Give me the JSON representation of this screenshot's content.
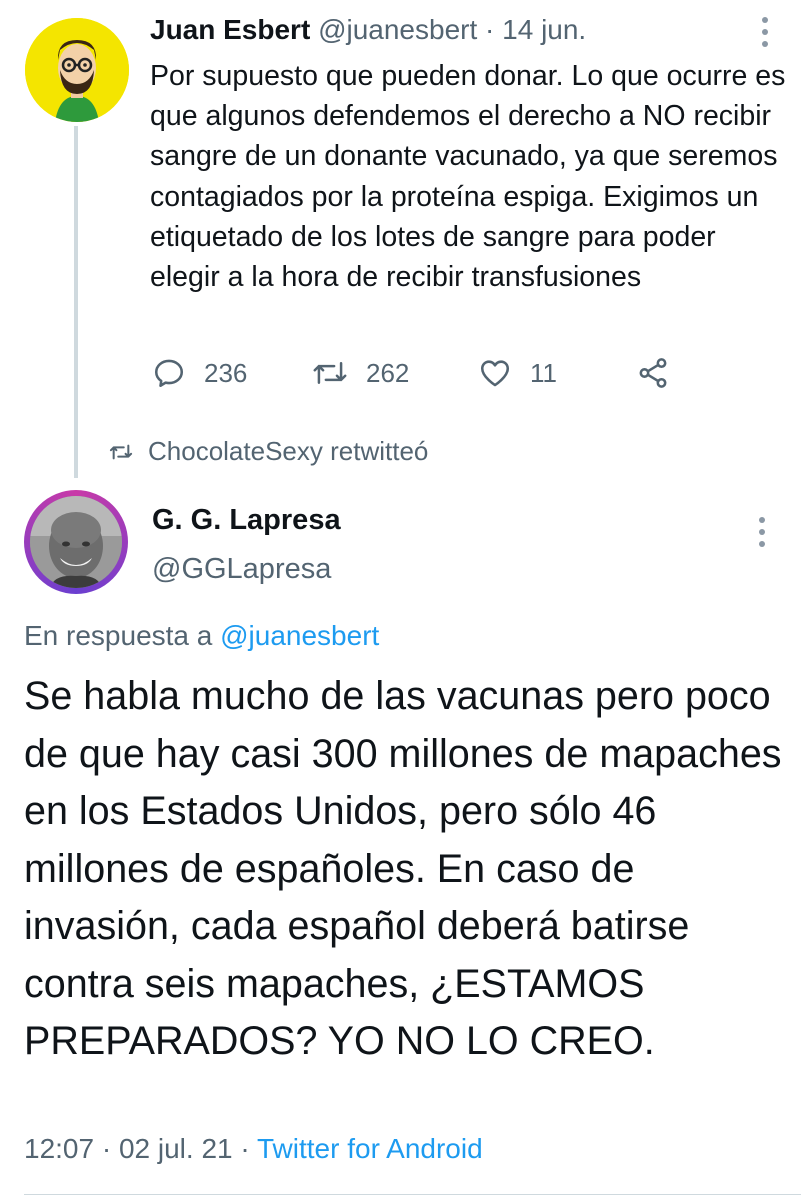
{
  "tweet1": {
    "author_name": "Juan Esbert",
    "author_handle": "@juanesbert",
    "separator": " · ",
    "date": "14 jun.",
    "text": "Por supuesto que pueden donar. Lo que ocurre es que algunos defendemos el derecho a NO recibir sangre de un donante vacunado, ya que seremos contagiados por la proteína espiga. Exigimos un etiquetado de los lotes de sangre para poder elegir a la hora de recibir transfusiones",
    "replies": "236",
    "retweets": "262",
    "likes": "11",
    "icons": [
      "reply-icon",
      "retweet-icon",
      "like-icon",
      "share-icon",
      "more-icon"
    ]
  },
  "retweet_context": {
    "label": "ChocolateSexy retwitteó",
    "icon": "retweet-icon"
  },
  "tweet2": {
    "author_name": "G. G. Lapresa",
    "author_handle": "@GGLapresa",
    "reply_prefix": "En respuesta a ",
    "reply_handle": "@juanesbert",
    "text": "Se habla mucho de las vacunas pero poco de que hay casi 300 millones de mapaches en los Estados Unidos, pero sólo 46 millones de españoles. En caso de invasión, cada español deberá batirse contra seis mapaches, ¿ESTAMOS PREPARADOS? YO NO LO CREO.",
    "time": "12:07",
    "separator": " · ",
    "date": "02 jul. 21",
    "source": "Twitter for Android"
  },
  "colors": {
    "text": "#0f1419",
    "secondary": "#536471",
    "link": "#1d9bf0",
    "avatar1_bg": "#f4e500",
    "divider": "#cfd9de"
  }
}
